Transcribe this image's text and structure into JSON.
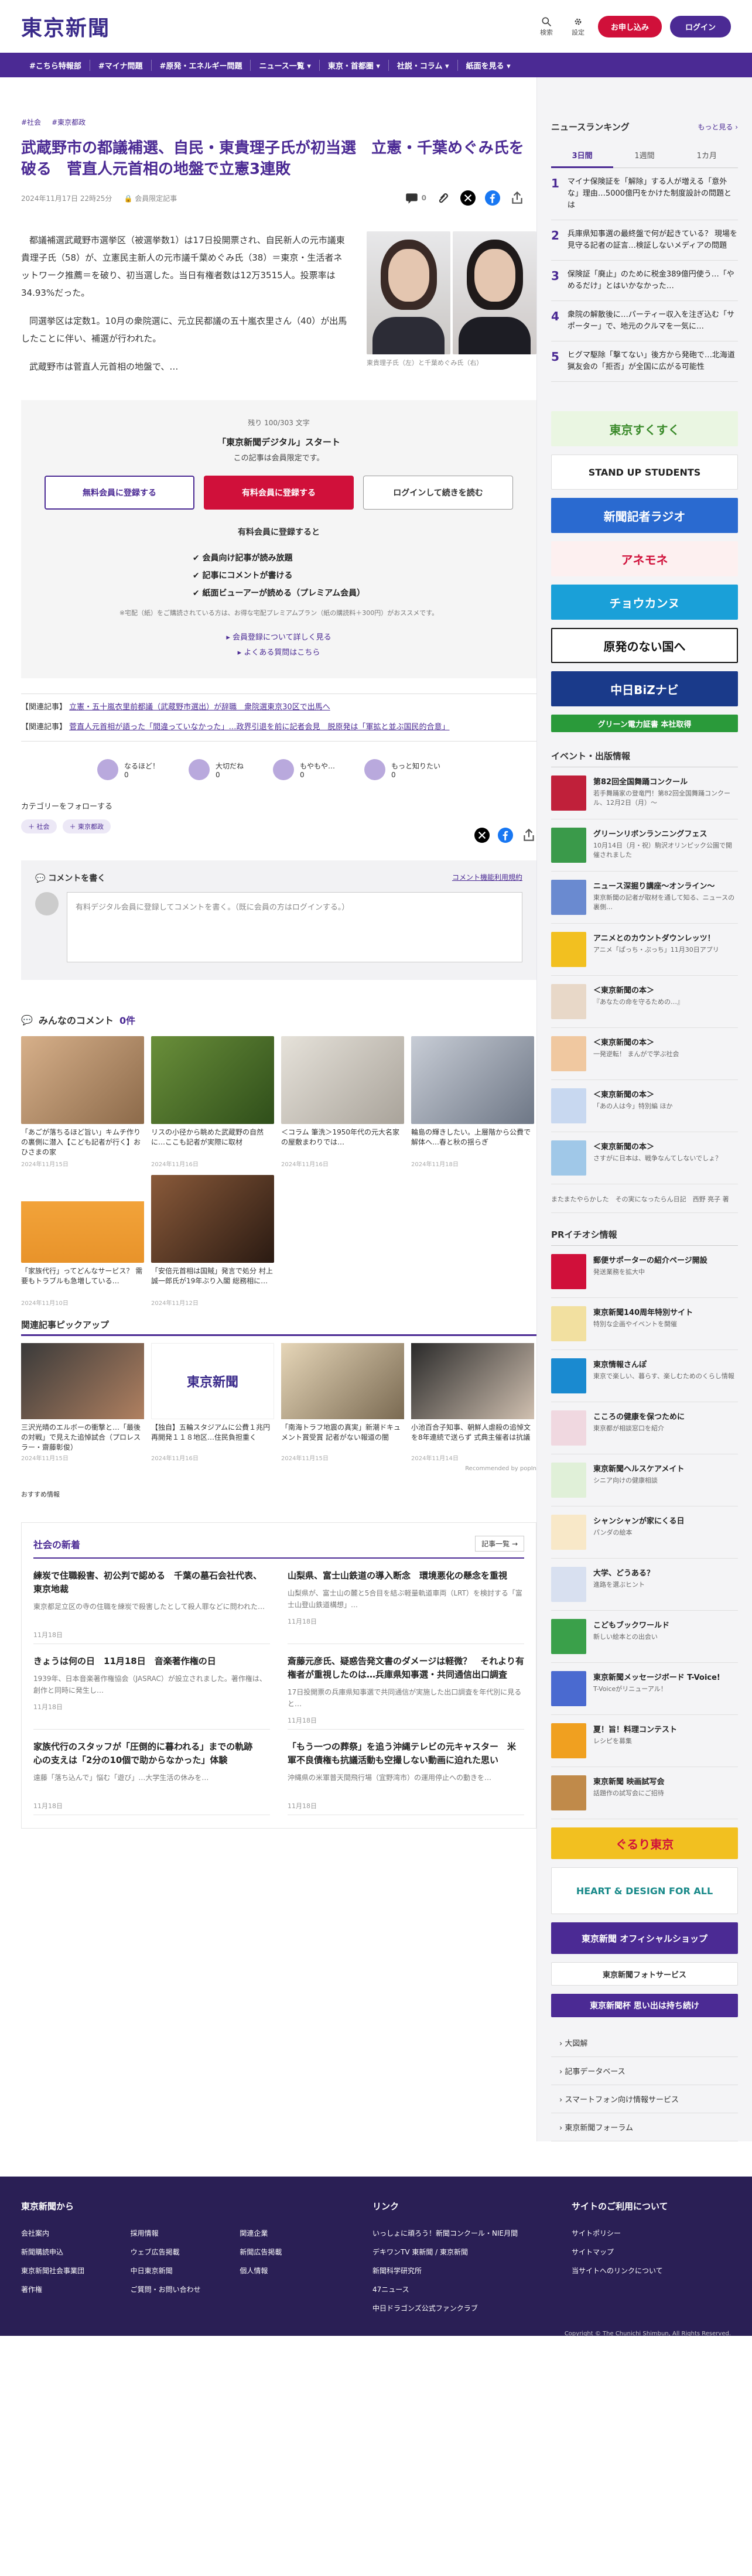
{
  "header": {
    "logo": "東京新聞",
    "search_label": "検索",
    "settings_label": "設定",
    "subscribe": "お申し込み",
    "login": "ログイン"
  },
  "nav": [
    "#こちら特報部",
    "#マイナ問題",
    "#原発・エネルギー問題",
    "ニュース一覧 ▾",
    "東京・首都圏 ▾",
    "社説・コラム ▾",
    "紙面を見る ▾"
  ],
  "article": {
    "tags": [
      "#社会",
      "#東京都政"
    ],
    "title": "武蔵野市の都議補選、自民・東貴理子氏が初当選　立憲・千葉めぐみ氏を破る　菅直人元首相の地盤で立憲3連敗",
    "date": "2024年11月17日 22時25分",
    "member_label": "会員限定記事",
    "comment_count": "0",
    "paragraphs": [
      "都議補選武蔵野市選挙区（被選挙数1）は17日投開票され、自民新人の元市議東貴理子氏（58）が、立憲民主新人の元市議千葉めぐみ氏（38）＝東京・生活者ネットワーク推薦＝を破り、初当選した。当日有権者数は12万3515人。投票率は34.93%だった。",
      "同選挙区は定数1。10月の衆院選に、元立民都議の五十嵐衣里さん（40）が出馬したことに伴い、補選が行われた。",
      "武蔵野市は菅直人元首相の地盤で、…"
    ],
    "photo_caption": "東貴理子氏（左）と千葉めぐみ氏（右）"
  },
  "paywall": {
    "remaining": "残り 100/303 文字",
    "head": "「東京新聞デジタル」スタート",
    "sub": "この記事は会員限定です。",
    "btn_free": "無料会員に登録する",
    "btn_paid": "有料会員に登録する",
    "btn_login": "ログインして続きを読む",
    "if_paid": "有料会員に登録すると",
    "benefits": [
      "✔ 会員向け記事が読み放題",
      "✔ 記事にコメントが書ける",
      "✔ 紙面ビューアーが読める（プレミアム会員）"
    ],
    "note": "※宅配（紙）をご購読されている方は、お得な宅配プレミアムプラン（紙の購読料＋300円）がおススメです。",
    "link1": "▸ 会員登録について詳しく見る",
    "link2": "▸ よくある質問はこちら"
  },
  "related": [
    {
      "label": "【関連記事】",
      "text": "立憲・五十嵐衣里前都議（武蔵野市選出）が辞職　衆院選東京30区で出馬へ"
    },
    {
      "label": "【関連記事】",
      "text": "菅直人元首相が語った「間違っていなかった」…政界引退を前に記者会見　脱原発は「軍拡と並ぶ国民的合意」"
    }
  ],
  "reactions": [
    {
      "label": "なるほど！",
      "count": "0"
    },
    {
      "label": "大切だね",
      "count": "0"
    },
    {
      "label": "もやもや…",
      "count": "0"
    },
    {
      "label": "もっと知りたい",
      "count": "0"
    }
  ],
  "follow": {
    "title": "カテゴリーをフォローする",
    "chips": [
      "＋ 社会",
      "＋ 東京都政"
    ]
  },
  "comment_box": {
    "title": "コメントを書く",
    "link": "コメント機能利用規約",
    "field": "有料デジタル会員に登録してコメントを書く。（既に会員の方はログインする。）"
  },
  "comments_title": "みんなのコメント",
  "comments_count": "0件",
  "comment_cards": [
    {
      "text": "「あごが落ちるほど旨い」キムチ作りの裏側に潜入【こども記者が行く】おひさまの家",
      "date": "2024年11月15日"
    },
    {
      "text": "リスの小径から眺めた武蔵野の自然に…ここも記者が実際に取材",
      "date": "2024年11月16日"
    },
    {
      "text": "＜コラム 筆洗＞1950年代の元大名家の屋敷まわりでは…",
      "date": "2024年11月16日"
    },
    {
      "text": "輪島の輝きしたい。上層階から公費で解体へ…春と秋の揺らぎ",
      "date": "2024年11月18日"
    },
    {
      "text": "「家族代行」ってどんなサービス？ 需要もトラブルも急増している…",
      "date": "2024年11月10日"
    },
    {
      "text": "「安倍元首相は国賊」発言で処分 村上誠一郎氏が19年ぶり入閣 総務相に…",
      "date": "2024年11月12日"
    }
  ],
  "pickup_title": "関連記事ピックアップ",
  "pickup": [
    {
      "text": "三沢光晴のエルボーの衝撃と…「最後の対戦」で見えた追悼試合（プロレスラー・齋藤彰俊）",
      "date": "2024年11月15日"
    },
    {
      "text": "【独自】五輪スタジアムに公費１兆円 再開発１１８地区…住民負担重く",
      "date": "2024年11月16日"
    },
    {
      "text": "「南海トラフ地震の真実」新潮ドキュメント賞受賞 記者がない報道の闇",
      "date": "2024年11月15日"
    },
    {
      "text": "小池百合子知事、朝鮮人虐殺の追悼文を8年連続で送らず 式典主催者は抗議",
      "date": "2024年11月14日"
    }
  ],
  "recommend": "Recommended by popIn",
  "recommend_small": "おすすめ情報",
  "news": {
    "title": "社会の新着",
    "more": "記事一覧 →",
    "items": [
      {
        "title": "練炭で住職殺害、初公判で認める　千葉の墓石会社代表、東京地裁",
        "body": "東京都足立区の寺の住職を練炭で殺害したとして殺人罪などに問われた…",
        "date": "11月18日"
      },
      {
        "title": "山梨県、富士山鉄道の導入断念　環境悪化の懸念を重視",
        "body": "山梨県が、富士山の麓と5合目を結ぶ軽量軌道車両（LRT）を検討する「富士山登山鉄道構想」…",
        "date": "11月18日"
      },
      {
        "title": "きょうは何の日　11月18日　音楽著作権の日",
        "body": "1939年、日本音楽著作権協会（JASRAC）が設立されました。著作権は、創作と同時に発生し…",
        "date": "11月18日"
      },
      {
        "title": "斎藤元彦氏、疑惑告発文書のダメージは軽微？　それより有権者が重視したのは…兵庫県知事選・共同通信出口調査",
        "body": "17日投開票の兵庫県知事選で共同通信が実施した出口調査を年代別に見ると…",
        "date": "11月18日"
      },
      {
        "title": "家族代行のスタッフが「圧倒的に暮われる」までの軌跡　心の支えは「2分の10個で助からなかった」体験",
        "body": "遠藤「落ち込んで」悩む「遊び」…大学生活の休みを…",
        "date": "11月18日"
      },
      {
        "title": "「もう一つの葬祭」を追う沖縄テレビの元キャスター　米軍不良債権も抗議活動も空撮しない動画に迫れた思い",
        "body": "沖縄県の米軍普天間飛行場（宜野湾市）の運用停止への動きを…",
        "date": "11月18日"
      }
    ]
  },
  "ranking": {
    "title": "ニュースランキング",
    "more": "もっと見る ›",
    "tabs": [
      "3日間",
      "1週間",
      "1カ月"
    ],
    "items": [
      "マイナ保険証を「解除」する人が増える「意外な」理由…5000億円をかけた制度設計の問題とは",
      "兵庫県知事選の最終盤で何が起きている？ 現場を見守る記者の証言…検証しないメディアの問題",
      "保険証「廃止」のために税金389億円使う…「やめるだけ」とはいかなかった…",
      "衆院の解散後に…パーティー収入を注ぎ込む「サポーター」で、地元のクルマを一気に…",
      "ヒグマ駆除「撃てない」後方から発砲で…北海道猟友会の「拒否」が全国に広がる可能性"
    ]
  },
  "banners": [
    "東京すくすく",
    "STAND UP STUDENTS",
    "新聞記者ラジオ",
    "アネモネ",
    "チョウカンヌ",
    "原発のない国へ",
    "中日BiZナビ",
    "グリーン電力証書 本社取得"
  ],
  "events_title": "イベント・出版情報",
  "events": [
    {
      "t": "第82回全国舞踊コンクール",
      "s": "若手舞踊家の登竜門！第82回全国舞踊コンクール、12月2日（月）～"
    },
    {
      "t": "グリーンリボンランニングフェス",
      "s": "10月14日（月・祝）駒沢オリンピック公園で開催されました"
    },
    {
      "t": "ニュース深掘り講座～オンライン～",
      "s": "東京新聞の記者が取材を通して知る、ニュースの裏側…"
    },
    {
      "t": "アニメとのカウントダウンレッツ！",
      "s": "アニメ「ぱっち・ぷっち」11月30日アプリ　"
    },
    {
      "t": "＜東京新聞の本＞",
      "s": "『あなたの命を守るための…』"
    },
    {
      "t": "＜東京新聞の本＞",
      "s": "一発逆転！ まんがで学ぶ社会"
    },
    {
      "t": "＜東京新聞の本＞",
      "s": "「あの人は今」特別編 ほか"
    },
    {
      "t": "＜東京新聞の本＞",
      "s": "さすがに日本は、戦争なんてしないでしょ？"
    }
  ],
  "events_more": "またまたやらかした　その実になったらん日記　西野 亮子 著",
  "pr_title": "PRイチオシ情報",
  "pr": [
    {
      "t": "郵便サポーターの紹介ページ開設",
      "s": "発送業務を拡大中"
    },
    {
      "t": "東京新聞140周年特別サイト",
      "s": "特別な企画やイベントを開催"
    },
    {
      "t": "東京情報さんぽ",
      "s": "東京で楽しい、暮らす、楽しむためのくらし情報"
    },
    {
      "t": "こころの健康を保つために",
      "s": "東京都が相談窓口を紹介"
    },
    {
      "t": "東京新聞ヘルスケアメイト",
      "s": "シニア向けの健康相談"
    },
    {
      "t": "シャンシャンが家にくる日",
      "s": "パンダの絵本"
    },
    {
      "t": "大学、どうある？",
      "s": "進路を選ぶヒント"
    },
    {
      "t": "こどもブックワールド",
      "s": "新しい絵本との出会い"
    },
    {
      "t": "東京新聞メッセージボード T-Voice!",
      "s": "T-Voiceがリニューアル！"
    },
    {
      "t": "夏！旨！料理コンテスト",
      "s": "レシピを募集"
    },
    {
      "t": "東京新聞 映画試写会",
      "s": "話題作の試写会にご招待"
    }
  ],
  "side_banners": [
    "ぐるり東京",
    "HEART & DESIGN FOR ALL",
    "東京新聞 オフィシャルショップ",
    "東京新聞フォトサービス",
    "東京新聞杯 思い出は持ち続け"
  ],
  "side_links": [
    "› 大図解",
    "› 記事データベース",
    "› スマートフォン向け情報サービス",
    "› 東京新聞フォーラム"
  ],
  "footer": {
    "cols": [
      {
        "h": "東京新聞から",
        "items": [
          "会社案内",
          "新聞購読申込",
          "東京新聞社会事業団",
          "著作権",
          "採用情報",
          "ウェブ広告掲載",
          "中日東京新聞",
          "ご質問・お問い合わせ",
          "関連企業",
          "新聞広告掲載",
          "個人情報"
        ]
      },
      {
        "h": "リンク",
        "items": [
          "いっしょに頑ろう！新聞コンクール・NIE月間",
          "デキワンTV 東新聞 / 東京新聞",
          "新聞科学研究所",
          "47ニュース",
          "中日ドラゴンズ公式ファンクラブ"
        ]
      },
      {
        "h": "サイトのご利用について",
        "items": [
          "サイトポリシー",
          "サイトマップ",
          "当サイトへのリンクについて"
        ]
      }
    ],
    "copyright": "Copyright © The Chunichi Shimbun, All Rights Reserved."
  }
}
